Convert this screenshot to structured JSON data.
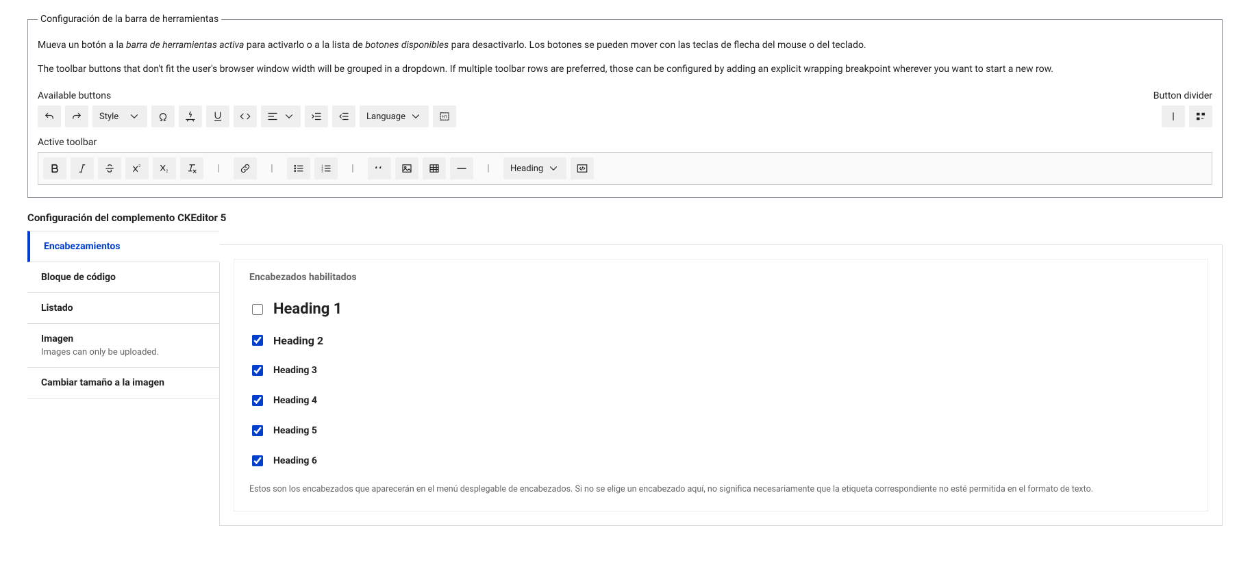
{
  "fieldset": {
    "legend": "Configuración de la barra de herramientas",
    "instruction1_a": "Mueva un botón a la ",
    "instruction1_em1": "barra de herramientas activa",
    "instruction1_b": " para activarlo o a la lista de ",
    "instruction1_em2": "botones disponibles",
    "instruction1_c": " para desactivarlo. Los botones se pueden mover con las teclas de flecha del mouse o del teclado.",
    "instruction2": "The toolbar buttons that don't fit the user's browser window width will be grouped in a dropdown. If multiple toolbar rows are preferred, those can be configured by adding an explicit wrapping breakpoint wherever you want to start a new row.",
    "available_label": "Available buttons",
    "divider_label": "Button divider",
    "active_label": "Active toolbar"
  },
  "available_buttons": {
    "style": "Style",
    "language": "Language"
  },
  "active_toolbar": {
    "heading": "Heading"
  },
  "plugin_section_title": "Configuración del complemento CKEditor 5",
  "tabs": [
    {
      "label": "Encabezamientos",
      "sub": ""
    },
    {
      "label": "Bloque de código",
      "sub": ""
    },
    {
      "label": "Listado",
      "sub": ""
    },
    {
      "label": "Imagen",
      "sub": "Images can only be uploaded."
    },
    {
      "label": "Cambiar tamaño a la imagen",
      "sub": ""
    }
  ],
  "headings_panel": {
    "title": "Encabezados habilitados",
    "options": [
      {
        "label": "Heading 1",
        "checked": false
      },
      {
        "label": "Heading 2",
        "checked": true
      },
      {
        "label": "Heading 3",
        "checked": true
      },
      {
        "label": "Heading 4",
        "checked": true
      },
      {
        "label": "Heading 5",
        "checked": true
      },
      {
        "label": "Heading 6",
        "checked": true
      }
    ],
    "help": "Estos son los encabezados que aparecerán en el menú desplegable de encabezados. Si no se elige un encabezado aquí, no significa necesariamente que la etiqueta correspondiente no esté permitida en el formato de texto."
  }
}
